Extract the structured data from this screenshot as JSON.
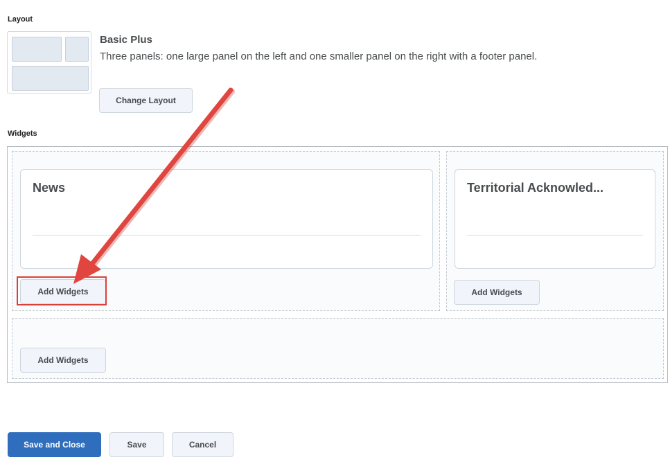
{
  "layout_section": {
    "label": "Layout",
    "layout_name": "Basic Plus",
    "layout_description": "Three panels: one large panel on the left and one smaller panel on the right with a footer panel.",
    "change_layout_label": "Change Layout"
  },
  "widgets_section": {
    "label": "Widgets",
    "left_panel": {
      "widget_title": "News",
      "add_widgets_label": "Add Widgets"
    },
    "right_panel": {
      "widget_title": "Territorial Acknowled...",
      "add_widgets_label": "Add Widgets"
    },
    "footer_panel": {
      "add_widgets_label": "Add Widgets"
    }
  },
  "footer_actions": {
    "save_and_close_label": "Save and Close",
    "save_label": "Save",
    "cancel_label": "Cancel"
  },
  "colors": {
    "primary_button": "#2f6dbd",
    "annotation_red": "#d9403a"
  }
}
